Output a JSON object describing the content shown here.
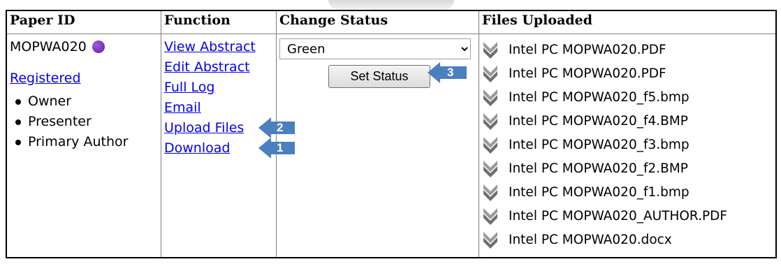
{
  "table": {
    "headers": [
      "Paper ID",
      "Function",
      "Change Status",
      "Files Uploaded"
    ],
    "paper_id": "MOPWA020",
    "registered_link": "Registered",
    "roles": [
      "Owner",
      "Presenter",
      "Primary Author"
    ],
    "functions": [
      "View Abstract",
      "Edit Abstract",
      "Full Log",
      "Email",
      "Upload Files",
      "Download"
    ],
    "status_select": {
      "selected": "Green"
    },
    "set_status_label": "Set Status",
    "files": [
      "Intel PC MOPWA020.PDF",
      "Intel PC MOPWA020.PDF",
      "Intel PC MOPWA020_f5.bmp",
      "Intel PC MOPWA020_f4.BMP",
      "Intel PC MOPWA020_f3.bmp",
      "Intel PC MOPWA020_f2.BMP",
      "Intel PC MOPWA020_f1.bmp",
      "Intel PC MOPWA020_AUTHOR.PDF",
      "Intel PC MOPWA020.docx"
    ]
  },
  "callouts": {
    "download": "1",
    "upload_files": "2",
    "set_status": "3"
  },
  "colors": {
    "link": "#0000ee",
    "callout": "#4a7fc0",
    "status_dot": "#6a2bb0",
    "chevron": "#8a8a8a"
  },
  "icons": {
    "file_row": "chevron-down-icon",
    "status": "purple-dot-icon"
  }
}
